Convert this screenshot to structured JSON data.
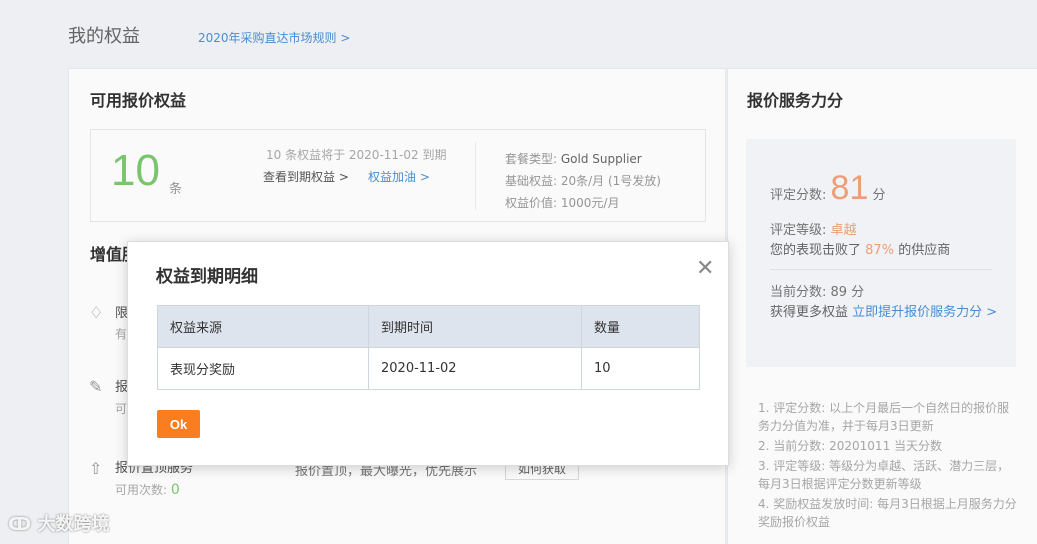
{
  "header": {
    "title": "我的权益",
    "rules_link": "2020年采购直达市场规则 >"
  },
  "quota": {
    "panel_title": "可用报价权益",
    "count": "10",
    "unit": "条",
    "expire_note": "10 条权益将于 2020-11-02 到期",
    "view_expire": "查看到期权益  >",
    "add_quota": "权益加油  >",
    "package_type_label": "套餐类型:",
    "package_type": "Gold Supplier",
    "base_quota": "基础权益: 20条/月  (1号发放)",
    "quota_value": "权益价值: 1000元/月"
  },
  "value_added": {
    "title": "增值服",
    "services": [
      {
        "icon": "diamond-icon",
        "name": "限",
        "sub": "有"
      },
      {
        "icon": "edit-doc-icon",
        "name": "报",
        "sub": "可"
      },
      {
        "icon": "top-arrow-icon",
        "name": "报价置顶服务",
        "sub_label": "可用次数:",
        "count": "0",
        "desc": "报价置顶，最大曝光，优先展示",
        "btn": "如何获取"
      }
    ]
  },
  "service_score": {
    "title": "报价服务力分",
    "rating_label": "评定分数:",
    "rating_value": "81",
    "rating_unit": "分",
    "level_label": "评定等级:",
    "level_value": "卓越",
    "beat_prefix": "您的表现击败了",
    "beat_value": "87%",
    "beat_suffix": "的供应商",
    "current_label": "当前分数: 89 分",
    "more_prefix": "获得更多权益",
    "more_link": "立即提升报价服务力分 >",
    "notes": [
      "1. 评定分数: 以上个月最后一个自然日的报价服务力分值为准，并于每月3日更新",
      "2. 当前分数: 20201011 当天分数",
      "3. 评定等级: 等级分为卓越、活跃、潜力三层，每月3日根据评定分数更新等级",
      "4. 奖励权益发放时间: 每月3日根据上月服务力分奖励报价权益"
    ]
  },
  "modal": {
    "title": "权益到期明细",
    "columns": [
      "权益来源",
      "到期时间",
      "数量"
    ],
    "rows": [
      [
        "表现分奖励",
        "2020-11-02",
        "10"
      ]
    ],
    "ok": "Ok"
  },
  "watermark": "大数跨境",
  "colors": {
    "accent_orange": "#fa7d20",
    "link_blue": "#4a90d9",
    "quota_green": "#7bc96f",
    "score_orange": "#f0a27a"
  }
}
